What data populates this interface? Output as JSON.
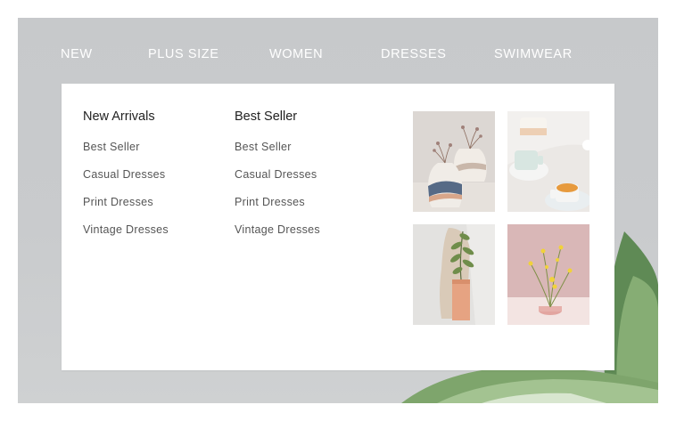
{
  "nav": {
    "items": [
      {
        "label": "NEW"
      },
      {
        "label": "PLUS SIZE"
      },
      {
        "label": "WOMEN"
      },
      {
        "label": "DRESSES"
      },
      {
        "label": "SWIMWEAR"
      }
    ]
  },
  "menu": {
    "columns": [
      {
        "title": "New Arrivals",
        "links": [
          "Best Seller",
          "Casual Dresses",
          "Print Dresses",
          "Vintage Dresses"
        ]
      },
      {
        "title": "Best Seller",
        "links": [
          "Best Seller",
          "Casual Dresses",
          "Print Dresses",
          "Vintage Dresses"
        ]
      }
    ],
    "images": [
      {
        "name": "ceramic-vases-with-dried-flowers"
      },
      {
        "name": "ceramic-cups-on-marble"
      },
      {
        "name": "vase-with-green-sprig"
      },
      {
        "name": "yellow-flowers-on-pink-background"
      }
    ]
  },
  "colors": {
    "background": "#c8cacc",
    "panel": "#ffffff",
    "nav_text": "#ffffff",
    "heading_text": "#222222",
    "link_text": "#555555"
  }
}
